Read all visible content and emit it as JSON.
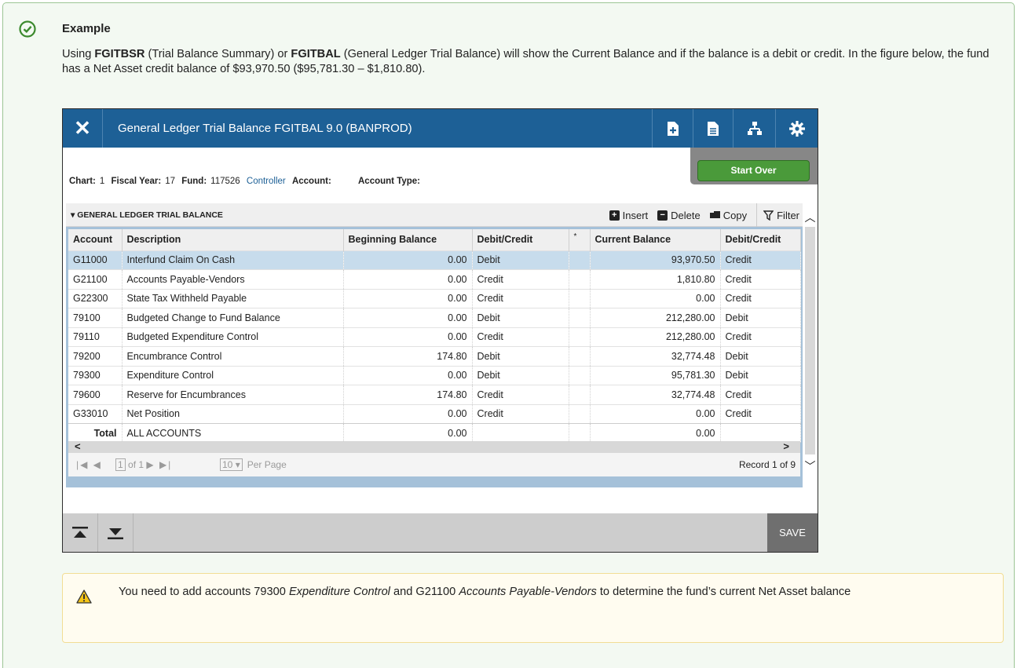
{
  "example": {
    "title": "Example",
    "intro_p1": "Using ",
    "intro_b1": "FGITBSR",
    "intro_p2": " (Trial Balance Summary) or ",
    "intro_b2": "FGITBAL",
    "intro_p3": " (General Ledger Trial Balance) will show the Current Balance and if the balance is a debit or credit. In the figure below, the fund has a Net Asset credit balance of $93,970.50 ($95,781.30 – $1,810.80)."
  },
  "app": {
    "title": "General Ledger Trial Balance FGITBAL 9.0 (BANPROD)",
    "close_glyph": "✕",
    "start_over": "Start Over",
    "key": {
      "chart_label": "Chart:",
      "chart_value": "1",
      "fy_label": "Fiscal Year:",
      "fy_value": "17",
      "fund_label": "Fund:",
      "fund_value": "117526",
      "fund_link": "Controller",
      "account_label": "Account:",
      "account_type_label": "Account Type:"
    },
    "section": {
      "title": "GENERAL LEDGER TRIAL BALANCE",
      "insert": "Insert",
      "delete": "Delete",
      "copy": "Copy",
      "filter": "Filter"
    },
    "grid": {
      "headers": [
        "Account",
        "Description",
        "Beginning Balance",
        "Debit/Credit",
        "*",
        "Current Balance",
        "Debit/Credit"
      ],
      "rows": [
        [
          "G11000",
          "Interfund Claim On Cash",
          "0.00",
          "Debit",
          "",
          "93,970.50",
          "Credit"
        ],
        [
          "G21100",
          "Accounts Payable-Vendors",
          "0.00",
          "Credit",
          "",
          "1,810.80",
          "Credit"
        ],
        [
          "G22300",
          "State Tax Withheld Payable",
          "0.00",
          "Credit",
          "",
          "0.00",
          "Credit"
        ],
        [
          "79100",
          "Budgeted Change to Fund Balance",
          "0.00",
          "Debit",
          "",
          "212,280.00",
          "Debit"
        ],
        [
          "79110",
          "Budgeted Expenditure Control",
          "0.00",
          "Credit",
          "",
          "212,280.00",
          "Credit"
        ],
        [
          "79200",
          "Encumbrance Control",
          "174.80",
          "Debit",
          "",
          "32,774.48",
          "Debit"
        ],
        [
          "79300",
          "Expenditure Control",
          "0.00",
          "Debit",
          "",
          "95,781.30",
          "Debit"
        ],
        [
          "79600",
          "Reserve for Encumbrances",
          "174.80",
          "Credit",
          "",
          "32,774.48",
          "Credit"
        ],
        [
          "G33010",
          "Net Position",
          "0.00",
          "Credit",
          "",
          "0.00",
          "Credit"
        ]
      ],
      "total": [
        "Total",
        "ALL ACCOUNTS",
        "0.00",
        "",
        "",
        "0.00",
        ""
      ]
    },
    "pager": {
      "page_box": "1",
      "of_pages": "of 1",
      "per_page_value": "10",
      "per_page_label": "Per Page",
      "record": "Record 1 of 9"
    },
    "save": "SAVE"
  },
  "warning": {
    "p1": "You need to add accounts 79300 ",
    "i1": "Expenditure Control",
    "p2": " and G21100 ",
    "i2": "Accounts Payable-Vendors",
    "p3": " to determine the fund’s current Net Asset balance"
  },
  "colors": {
    "titlebar": "#1d6096",
    "start_over": "#4a9a3a",
    "selected_row": "#c7dcec",
    "panel_bg": "#f3f9f2",
    "warning_bg": "#fffcf0"
  }
}
